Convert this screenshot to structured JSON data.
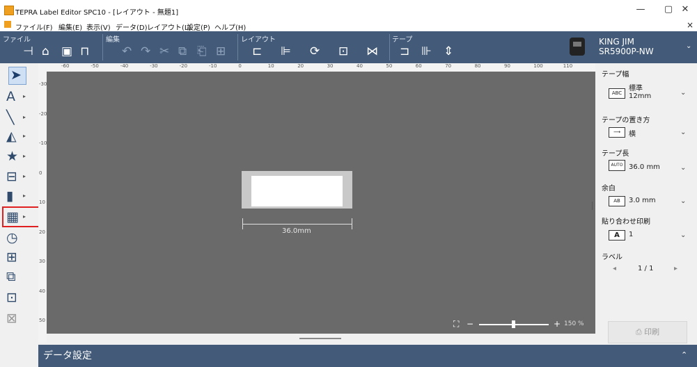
{
  "window": {
    "title": "TEPRA Label Editor SPC10 - [レイアウト - 無題1]",
    "minimize": "—",
    "restore": "▢",
    "close": "✕",
    "doc_close": "×"
  },
  "menu": [
    "ファイル(F)",
    "編集(E)",
    "表示(V)",
    "データ(D)",
    "レイアウト(L)",
    "設定(P)",
    "ヘルプ(H)"
  ],
  "ribbon": {
    "groups": {
      "file": "ファイル",
      "edit": "編集",
      "layout": "レイアウト",
      "tape": "テープ"
    },
    "printer_line1": "KING JIM",
    "printer_line2": "SR5900P-NW",
    "chevron": "⌄"
  },
  "rulers": {
    "h_ticks": [
      "-60",
      "-50",
      "-40",
      "-30",
      "-20",
      "-10",
      "0",
      "10",
      "20",
      "30",
      "40",
      "50",
      "60",
      "70",
      "80",
      "90",
      "100",
      "110"
    ],
    "v_ticks": [
      "-30",
      "-20",
      "-10",
      "0",
      "10",
      "20",
      "30",
      "40",
      "50"
    ]
  },
  "canvas": {
    "dimension": "36.0mm",
    "zoom": "150 %",
    "zoom_level_percent": 150
  },
  "right_panel": {
    "tape_width_label": "テープ幅",
    "tape_width_icon": "ABC",
    "tape_width_type": "標準",
    "tape_width_value": "12mm",
    "orientation_label": "テープの置き方",
    "orientation_value": "横",
    "tape_length_label": "テープ長",
    "tape_length_icon": "AUTO",
    "tape_length_value": "36.0 mm",
    "margin_label": "余白",
    "margin_icon": "AB",
    "margin_value": "3.0 mm",
    "paste_label": "貼り合わせ印刷",
    "paste_icon": "A",
    "paste_value": "1",
    "label_label": "ラベル",
    "label_page": "1 / 1",
    "prev": "◂",
    "next": "▸",
    "print_button": "印刷"
  },
  "bottom": {
    "title": "データ設定",
    "chevron": "⌃"
  }
}
